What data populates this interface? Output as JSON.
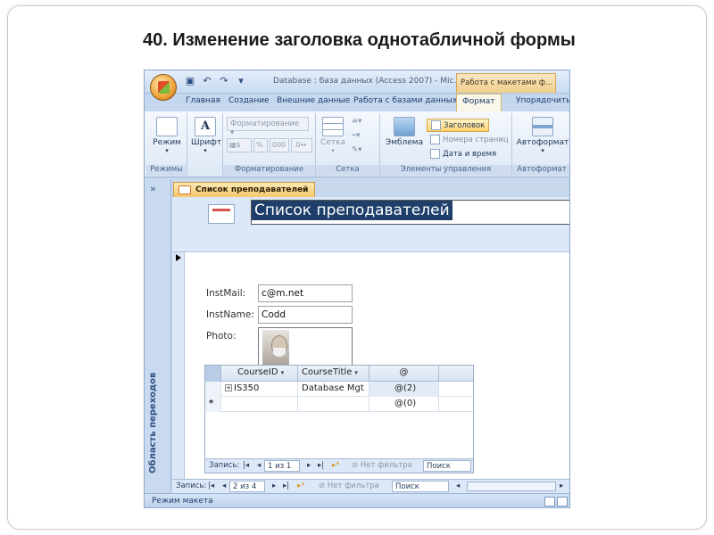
{
  "slide": {
    "title": "40. Изменение заголовка однотабличной формы"
  },
  "app": {
    "window_title": "Database : база данных (Access 2007) - Mic...",
    "context_tab_title": "Работа с макетами ф...",
    "tabs": [
      "Главная",
      "Создание",
      "Внешние данные",
      "Работа с базами данных",
      "Формат",
      "Упорядочить"
    ],
    "active_tab": "Формат"
  },
  "ribbon": {
    "views": {
      "button": "Режим",
      "group": "Режимы"
    },
    "font": {
      "button": "Шрифт"
    },
    "formatting": {
      "combo_placeholder": "Форматирование",
      "percent": "%",
      "thousands": "000",
      "group": "Форматирование"
    },
    "gridlines": {
      "button": "Сетка",
      "group": "Сетка"
    },
    "controls": {
      "logo_button": "Эмблема",
      "title_button": "Заголовок",
      "page_numbers_button": "Номера страниц",
      "date_time_button": "Дата и время",
      "group": "Элементы управления"
    },
    "autoformat": {
      "button": "Автоформат",
      "group": "Автоформат"
    }
  },
  "nav_pane": {
    "toggle": "»",
    "label": "Область переходов"
  },
  "document": {
    "tab_label": "Список преподавателей",
    "form_title": "Список преподавателей",
    "fields": [
      {
        "label": "InstMail:",
        "value": "c@m.net"
      },
      {
        "label": "InstName:",
        "value": "Codd"
      },
      {
        "label": "Photo:",
        "value": ""
      }
    ]
  },
  "subform": {
    "columns": [
      "CourseID",
      "CourseTitle",
      "@"
    ],
    "rows": [
      {
        "expand": "+",
        "course_id": "IS350",
        "course_title": "Database Mgt",
        "attachments": "@(2)"
      },
      {
        "marker": "*",
        "course_id": "",
        "course_title": "",
        "attachments": "@(0)"
      }
    ],
    "nav": {
      "label": "Запись:",
      "position": "1 из 1",
      "filter": "Нет фильтра",
      "search": "Поиск"
    }
  },
  "main_nav": {
    "label": "Запись:",
    "position": "2 из 4",
    "filter": "Нет фильтра",
    "search": "Поиск"
  },
  "status": {
    "text": "Режим макета"
  },
  "colors": {
    "accent": "#1f3f6b",
    "context_tab": "#f1cf8a",
    "ribbon": "#dde8f6"
  }
}
